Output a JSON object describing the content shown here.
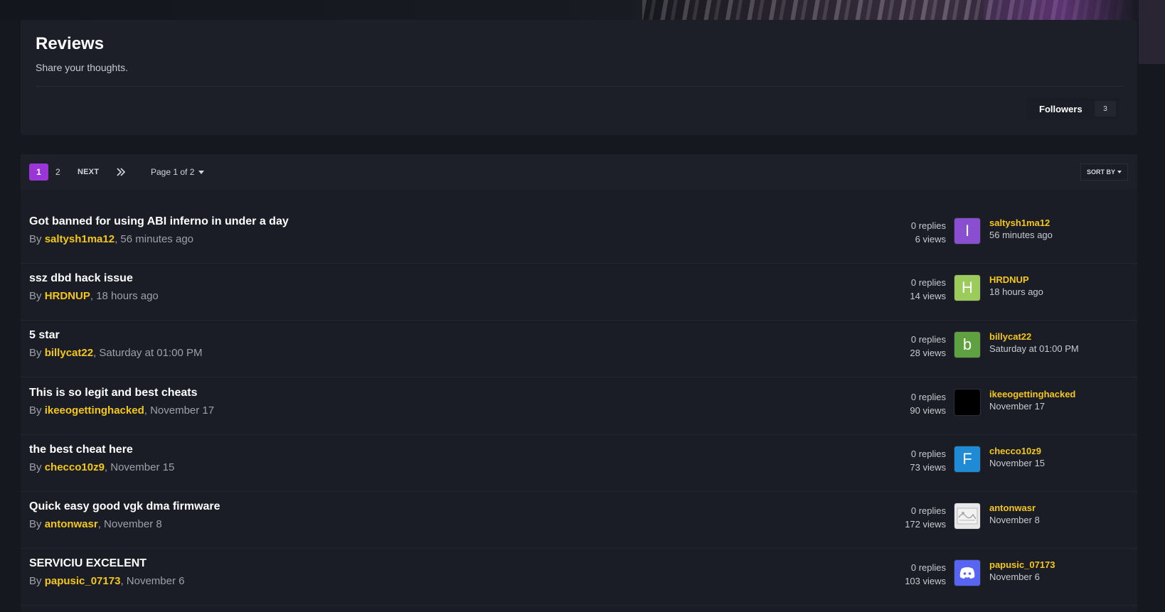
{
  "header": {
    "title": "Reviews",
    "description": "Share your thoughts.",
    "followers_label": "Followers",
    "followers_count": "3"
  },
  "pagination": {
    "current": "1",
    "page_2": "2",
    "next_label": "NEXT",
    "page_info": "Page 1 of 2",
    "sort_label": "SORT BY"
  },
  "topics": [
    {
      "title": "Got banned for using ABI inferno in under a day",
      "by": "By ",
      "author": "saltysh1ma12",
      "time": ", 56 minutes ago",
      "replies": "0 replies",
      "views": "6 views",
      "avatar_letter": "I",
      "avatar_color": "#8a4fd0",
      "last_poster": "saltysh1ma12",
      "last_time": "56 minutes ago"
    },
    {
      "title": "ssz dbd hack issue",
      "by": "By ",
      "author": "HRDNUP",
      "time": ", 18 hours ago",
      "replies": "0 replies",
      "views": "14 views",
      "avatar_letter": "H",
      "avatar_color": "#9acb5b",
      "last_poster": "HRDNUP",
      "last_time": "18 hours ago"
    },
    {
      "title": "5 star",
      "by": "By ",
      "author": "billycat22",
      "time": ", Saturday at 01:00 PM",
      "replies": "0 replies",
      "views": "28 views",
      "avatar_letter": "b",
      "avatar_color": "#5fa040",
      "last_poster": "billycat22",
      "last_time": "Saturday at 01:00 PM"
    },
    {
      "title": "This is so legit and best cheats",
      "by": "By ",
      "author": "ikeeogettinghacked",
      "time": ", November 17",
      "replies": "0 replies",
      "views": "90 views",
      "avatar_letter": "",
      "avatar_color": "#000000",
      "last_poster": "ikeeogettinghacked",
      "last_time": "November 17"
    },
    {
      "title": "the best cheat here",
      "by": "By ",
      "author": "checco10z9",
      "time": ", November 15",
      "replies": "0 replies",
      "views": "73 views",
      "avatar_letter": "F",
      "avatar_color": "#1f8ad6",
      "last_poster": "checco10z9",
      "last_time": "November 15"
    },
    {
      "title": "Quick easy good vgk dma firmware",
      "by": "By ",
      "author": "antonwasr",
      "time": ", November 8",
      "replies": "0 replies",
      "views": "172 views",
      "avatar_letter": "",
      "avatar_color": "#e8e8e8",
      "last_poster": "antonwasr",
      "last_time": "November 8"
    },
    {
      "title": "SERVICIU EXCELENT",
      "by": "By ",
      "author": "papusic_07173",
      "time": ", November 6",
      "replies": "0 replies",
      "views": "103 views",
      "avatar_letter": "",
      "avatar_color": "#5865f2",
      "last_poster": "papusic_07173",
      "last_time": "November 6"
    }
  ]
}
